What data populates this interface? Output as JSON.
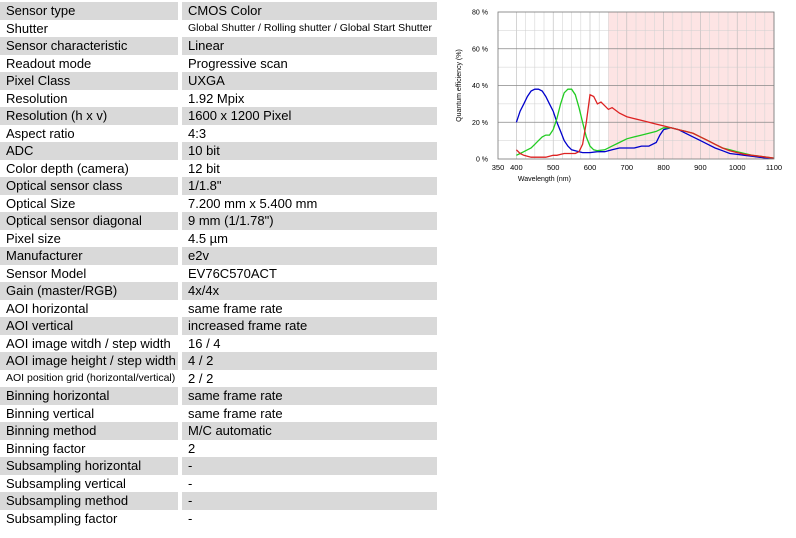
{
  "specs": [
    {
      "label": "Sensor type",
      "value": "CMOS Color"
    },
    {
      "label": "Shutter",
      "value": "Global Shutter / Rolling shutter / Global Start Shutter"
    },
    {
      "label": "Sensor characteristic",
      "value": "Linear"
    },
    {
      "label": "Readout mode",
      "value": "Progressive scan"
    },
    {
      "label": "Pixel Class",
      "value": "UXGA"
    },
    {
      "label": "Resolution",
      "value": "1.92 Mpix"
    },
    {
      "label": "Resolution (h x v)",
      "value": "1600 x 1200 Pixel"
    },
    {
      "label": "Aspect ratio",
      "value": "4:3"
    },
    {
      "label": "ADC",
      "value": "10 bit"
    },
    {
      "label": "Color depth (camera)",
      "value": "12 bit"
    },
    {
      "label": "Optical sensor class",
      "value": "1/1.8\""
    },
    {
      "label": "Optical Size",
      "value": "7.200 mm x 5.400 mm"
    },
    {
      "label": "Optical sensor diagonal",
      "value": "9 mm (1/1.78\")"
    },
    {
      "label": "Pixel size",
      "value": "4.5 µm"
    },
    {
      "label": "Manufacturer",
      "value": "e2v"
    },
    {
      "label": "Sensor Model",
      "value": "EV76C570ACT"
    },
    {
      "label": "Gain (master/RGB)",
      "value": "4x/4x"
    },
    {
      "label": "AOI horizontal",
      "value": "same frame rate"
    },
    {
      "label": "AOI vertical",
      "value": "increased frame rate"
    },
    {
      "label": "AOI image witdh / step width",
      "value": "16 / 4"
    },
    {
      "label": "AOI image height / step width",
      "value": "4 / 2"
    },
    {
      "label": "AOI position grid (horizontal/vertical)",
      "value": "2 / 2"
    },
    {
      "label": "Binning horizontal",
      "value": "same frame rate"
    },
    {
      "label": "Binning vertical",
      "value": "same frame rate"
    },
    {
      "label": "Binning method",
      "value": "M/C automatic"
    },
    {
      "label": "Binning factor",
      "value": "2"
    },
    {
      "label": "Subsampling horizontal",
      "value": "-"
    },
    {
      "label": "Subsampling vertical",
      "value": "-"
    },
    {
      "label": "Subsampling method",
      "value": "-"
    },
    {
      "label": "Subsampling factor",
      "value": "-"
    }
  ],
  "chart_data": {
    "type": "line",
    "title": "",
    "xlabel": "Wavelength (nm)",
    "ylabel": "Quantum efficiency (%)",
    "xlim": [
      350,
      1100
    ],
    "ylim": [
      0,
      80
    ],
    "xticks": [
      350,
      400,
      500,
      600,
      700,
      800,
      900,
      1000,
      1100
    ],
    "xtick_labels": [
      "350",
      "400",
      "500",
      "600",
      "700",
      "800",
      "900",
      "1000",
      "1100"
    ],
    "yticks": [
      0,
      20,
      40,
      60,
      80
    ],
    "ytick_labels": [
      "0 %",
      "20 %",
      "40 %",
      "60 %",
      "80 %"
    ],
    "grid": true,
    "legend": "none",
    "shaded_region": {
      "x_from": 650,
      "x_to": 1100,
      "color": "#fde4e4"
    },
    "series": [
      {
        "color": "#0000cc",
        "x": [
          400,
          410,
          420,
          430,
          440,
          450,
          460,
          470,
          480,
          490,
          500,
          510,
          520,
          530,
          540,
          550,
          560,
          570,
          580,
          590,
          600,
          620,
          640,
          660,
          680,
          700,
          720,
          740,
          760,
          780,
          790,
          800,
          820,
          840,
          860,
          880,
          900,
          920,
          940,
          960,
          980,
          1000,
          1020,
          1040,
          1060,
          1080,
          1100
        ],
        "y": [
          20,
          26,
          30,
          34,
          37,
          38,
          38,
          37,
          34,
          30,
          26,
          20,
          15,
          10,
          7,
          5,
          4.5,
          4,
          3.5,
          3.5,
          3.5,
          4,
          4,
          5,
          6,
          6,
          6,
          7,
          7,
          9,
          13,
          16,
          17,
          16,
          14,
          12,
          10,
          8,
          6,
          4.5,
          3,
          2.5,
          2,
          1.5,
          1,
          0.5,
          0.3
        ]
      },
      {
        "color": "#22cc22",
        "x": [
          400,
          410,
          420,
          430,
          440,
          450,
          460,
          470,
          480,
          490,
          500,
          510,
          520,
          530,
          540,
          550,
          560,
          570,
          580,
          590,
          600,
          610,
          620,
          640,
          660,
          680,
          700,
          720,
          740,
          760,
          780,
          800,
          820,
          840,
          860,
          880,
          900,
          920,
          940,
          960,
          980,
          1000,
          1020,
          1040,
          1060,
          1080,
          1100
        ],
        "y": [
          2,
          3,
          4,
          5,
          6,
          8,
          10,
          12,
          13,
          13,
          16,
          22,
          30,
          36,
          38,
          38,
          35,
          28,
          20,
          12,
          7,
          5,
          4.5,
          5,
          7,
          9,
          11,
          12,
          13,
          14,
          15,
          17,
          17,
          16,
          15,
          14,
          12,
          10,
          8,
          6,
          5,
          4,
          3,
          2,
          1.5,
          1,
          0.5
        ]
      },
      {
        "color": "#dd2222",
        "x": [
          400,
          410,
          420,
          430,
          440,
          450,
          460,
          470,
          480,
          490,
          500,
          510,
          520,
          530,
          540,
          550,
          560,
          570,
          580,
          590,
          600,
          610,
          620,
          630,
          640,
          650,
          660,
          680,
          700,
          720,
          740,
          760,
          780,
          800,
          820,
          840,
          860,
          880,
          900,
          920,
          940,
          960,
          980,
          1000,
          1020,
          1040,
          1060,
          1080,
          1100
        ],
        "y": [
          5,
          3,
          2,
          1.5,
          1,
          1,
          1,
          1,
          1,
          1.5,
          2,
          2,
          2.5,
          3,
          3,
          3,
          3,
          4,
          8,
          20,
          35,
          34,
          30,
          31,
          29,
          27,
          28,
          25,
          23,
          22,
          21,
          20,
          19,
          18,
          17,
          16,
          15,
          14,
          12,
          10,
          8,
          6,
          4.5,
          3.5,
          2.5,
          2,
          1.5,
          1,
          0.5
        ]
      }
    ]
  }
}
